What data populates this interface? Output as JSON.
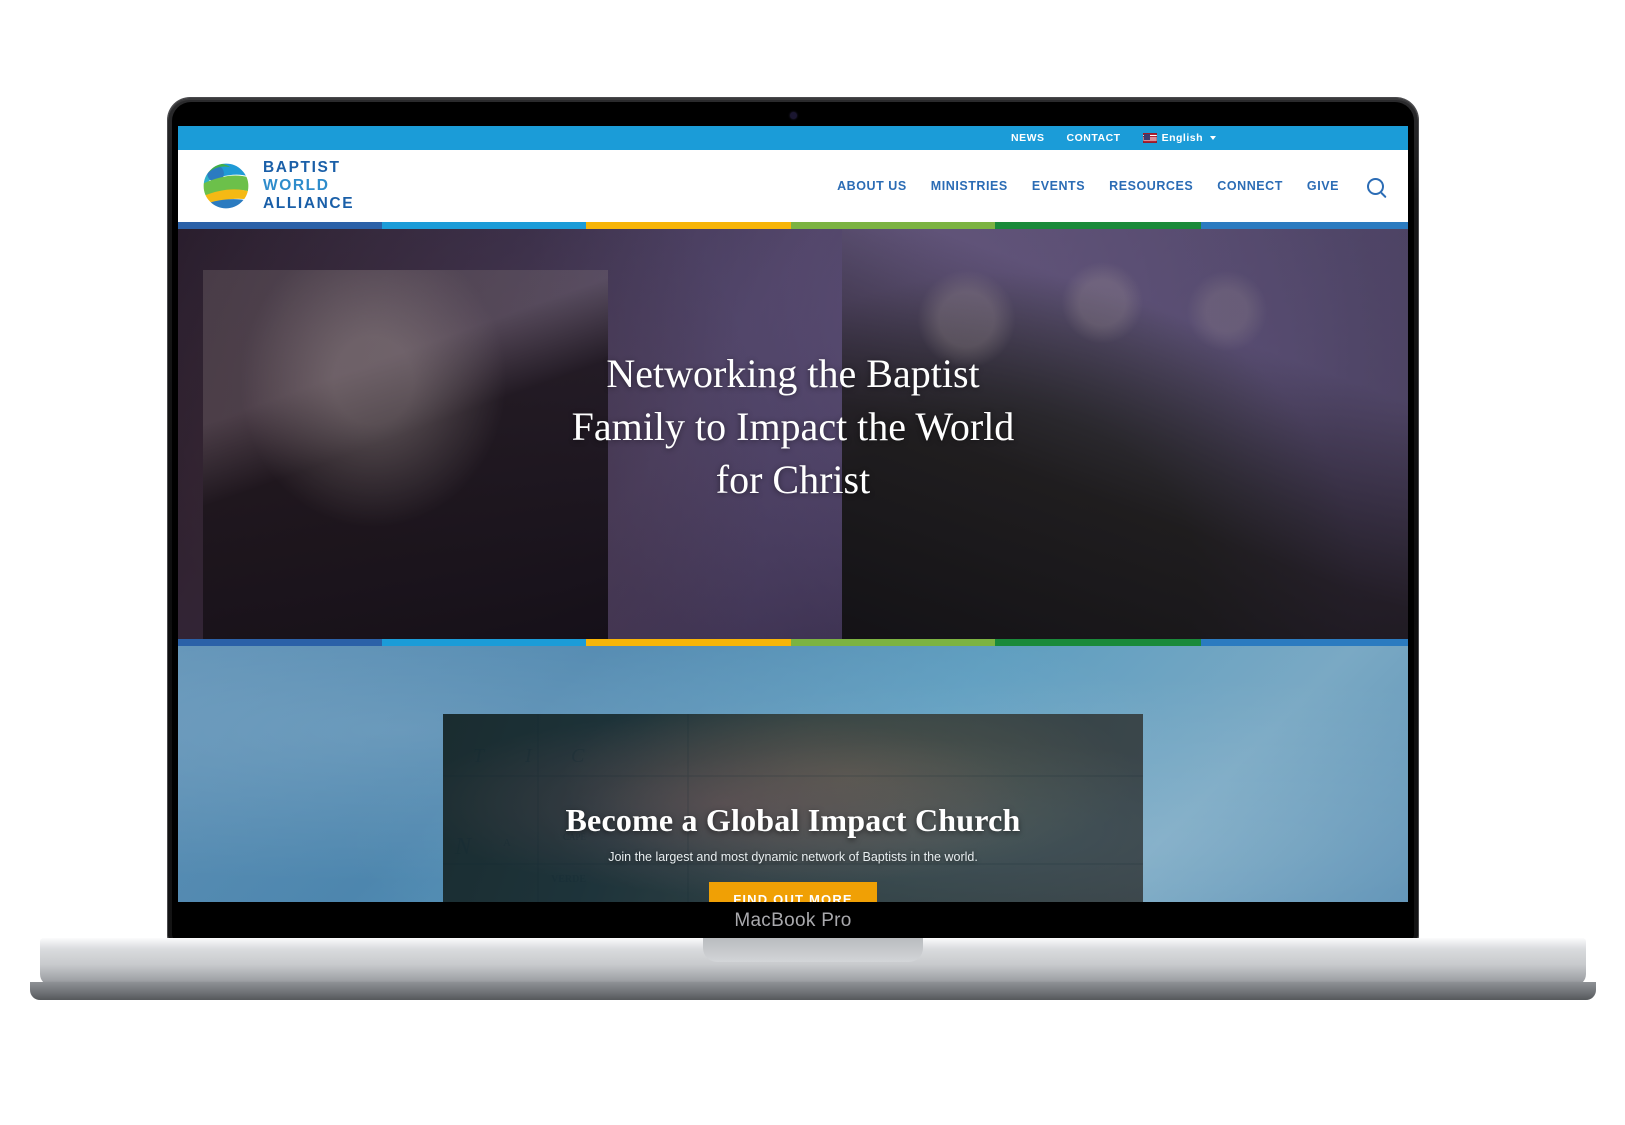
{
  "device": {
    "model_label": "MacBook Pro"
  },
  "site": {
    "topbar": {
      "news_label": "NEWS",
      "contact_label": "CONTACT",
      "language_label": "English",
      "flag_icon": "us-flag-icon",
      "caret_icon": "chevron-down-icon"
    },
    "brand": {
      "line1": "BAPTIST",
      "line2": "WORLD",
      "line3": "ALLIANCE",
      "logo_icon": "globe-logo-icon"
    },
    "nav": {
      "items": [
        {
          "label": "ABOUT US"
        },
        {
          "label": "MINISTRIES"
        },
        {
          "label": "EVENTS"
        },
        {
          "label": "RESOURCES"
        },
        {
          "label": "CONNECT"
        },
        {
          "label": "GIVE"
        }
      ],
      "search_icon": "search-icon"
    },
    "stripe": {
      "colors": [
        "#2b61a8",
        "#1b9cd8",
        "#f7b508",
        "#7cb342",
        "#1a8a3a",
        "#2b7bc0"
      ],
      "widths": [
        "16.6%",
        "16.6%",
        "16.6%",
        "16.6%",
        "16.8%",
        "16.8%"
      ]
    },
    "hero": {
      "title_line1": "Networking the Baptist",
      "title_line2": "Family to Impact the World",
      "title_line3": "for Christ"
    },
    "promo": {
      "heading": "Become a Global Impact Church",
      "subheading": "Join the largest and most dynamic network of Baptists in the world.",
      "cta_label": "FIND OUT MORE",
      "cta_color": "#f0a005"
    }
  }
}
